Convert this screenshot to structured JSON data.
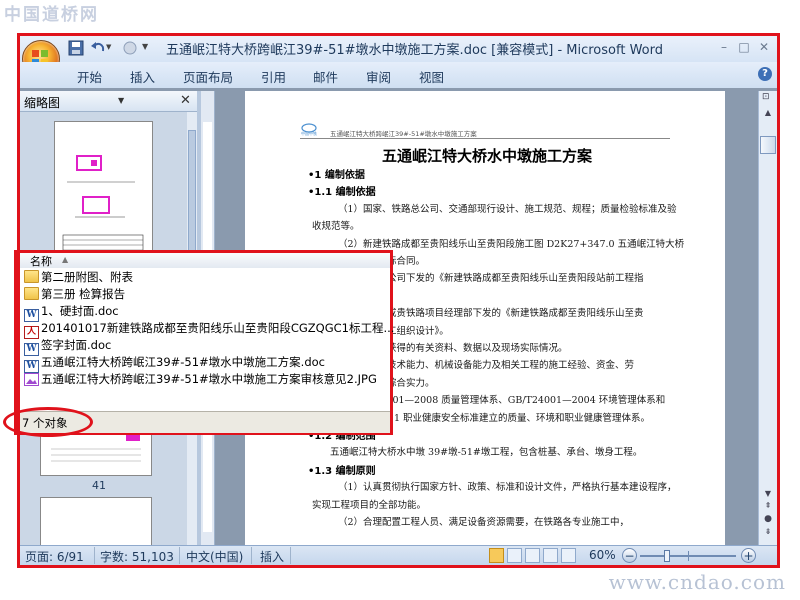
{
  "watermarks": {
    "top": "中国道桥网",
    "bottom": "www.cndao.com"
  },
  "window": {
    "title": "五通岷江特大桥跨岷江39#-51#墩水中墩施工方案.doc [兼容模式] - Microsoft Word",
    "buttons": {
      "minimize": "–",
      "maximize": "□",
      "close": "✕"
    }
  },
  "ribbon": {
    "tabs": [
      "开始",
      "插入",
      "页面布局",
      "引用",
      "邮件",
      "审阅",
      "视图"
    ],
    "help": "?"
  },
  "nav_pane": {
    "title": "缩略图",
    "page_label": "41"
  },
  "document": {
    "header_text": "五通岷江特大桥跨岷江39#-51#墩水中墩施工方案",
    "main_title": "五通岷江特大桥水中墩施工方案",
    "lines": [
      {
        "type": "h",
        "text": "•1 编制依据"
      },
      {
        "type": "h",
        "text": "•1.1 编制依据"
      },
      {
        "type": "p",
        "text": "（1）国家、铁路总公司、交通部现行设计、施工规范、规程；质量检验标准及验"
      },
      {
        "type": "p",
        "text": "收规范等。"
      },
      {
        "type": "p",
        "text": "（2）新建铁路成都至贵阳线乐山至贵阳段施工图 D2K27+347.0 五通岷江特大桥"
      },
      {
        "type": "p",
        "text": "及投标合同。"
      },
      {
        "type": "p",
        "text": "有限公司下发的《新建铁路成都至贵阳线乐山至贵阳段站前工程指"
      },
      {
        "type": "p",
        "text": ""
      },
      {
        "type": "p",
        "text": "集团成贵铁路项目经理部下发的《新建铁路成都至贵阳线乐山至贵"
      },
      {
        "type": "p",
        "text": "性施工组织设计》。"
      },
      {
        "type": "p",
        "text": "调查获得的有关资料、数据以及现场实际情况。"
      },
      {
        "type": "p",
        "text": "施工技术能力、机械设备能力及相关工程的施工经验、资金、劳"
      },
      {
        "type": "p",
        "text": "团的综合实力。"
      },
      {
        "type": "p",
        "text": "T19001—2008 质量管理体系、GB/T24001—2004 环境管理体系和"
      },
      {
        "type": "p",
        "text": "GB/T28001—2011 职业健康安全标准建立的质量、环境和职业健康管理体系。"
      },
      {
        "type": "h",
        "text": "•1.2 编制范围"
      },
      {
        "type": "p",
        "text": "五通岷江特大桥水中墩 39#墩-51#墩工程，包含桩基、承台、墩身工程。"
      },
      {
        "type": "h",
        "text": "•1.3 编制原则"
      },
      {
        "type": "p",
        "text": "（1）认真贯彻执行国家方针、政策、标准和设计文件，严格执行基本建设程序，"
      },
      {
        "type": "p",
        "text": "实现工程项目的全部功能。"
      },
      {
        "type": "p",
        "text": "（2）合理配置工程人员、满足设备资源需要，在铁路各专业施工中，"
      }
    ]
  },
  "file_list": {
    "column": "名称",
    "items": [
      {
        "icon": "folder-icon",
        "name": "第二册附图、附表"
      },
      {
        "icon": "folder-icon",
        "name": "第三册 检算报告"
      },
      {
        "icon": "word-doc-icon",
        "name": "1、硬封面.doc"
      },
      {
        "icon": "pdf-icon",
        "name": "201401017新建铁路成都至贵阳线乐山至贵阳段CGZQGC1标工程..."
      },
      {
        "icon": "word-doc-icon",
        "name": "签字封面.doc"
      },
      {
        "icon": "word-doc-icon",
        "name": "五通岷江特大桥跨岷江39#-51#墩水中墩施工方案.doc"
      },
      {
        "icon": "jpg-image-icon",
        "name": "五通岷江特大桥跨岷江39#-51#墩水中墩施工方案审核意见2.JPG"
      }
    ],
    "status": "7 个对象"
  },
  "status_bar": {
    "page": "页面: 6/91",
    "words": "字数: 51,103",
    "language": "中文(中国)",
    "mode": "插入",
    "zoom": "60%",
    "zoom_level_percent": 60
  },
  "colors": {
    "highlight_red": "#e0121b",
    "ribbon": "#d6e4f5",
    "word_blue": "#1e395b"
  }
}
